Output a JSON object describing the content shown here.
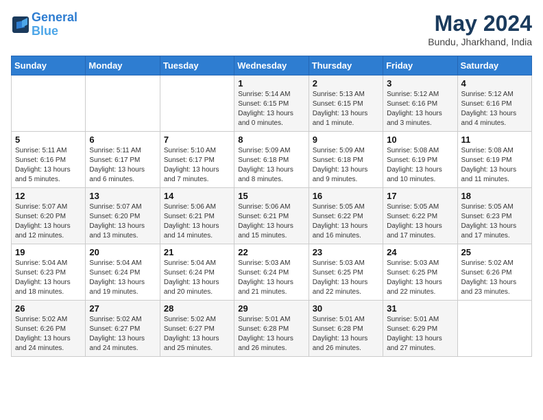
{
  "header": {
    "logo_line1": "General",
    "logo_line2": "Blue",
    "month": "May 2024",
    "location": "Bundu, Jharkhand, India"
  },
  "weekdays": [
    "Sunday",
    "Monday",
    "Tuesday",
    "Wednesday",
    "Thursday",
    "Friday",
    "Saturday"
  ],
  "weeks": [
    [
      {
        "day": "",
        "info": ""
      },
      {
        "day": "",
        "info": ""
      },
      {
        "day": "",
        "info": ""
      },
      {
        "day": "1",
        "info": "Sunrise: 5:14 AM\nSunset: 6:15 PM\nDaylight: 13 hours\nand 0 minutes."
      },
      {
        "day": "2",
        "info": "Sunrise: 5:13 AM\nSunset: 6:15 PM\nDaylight: 13 hours\nand 1 minute."
      },
      {
        "day": "3",
        "info": "Sunrise: 5:12 AM\nSunset: 6:16 PM\nDaylight: 13 hours\nand 3 minutes."
      },
      {
        "day": "4",
        "info": "Sunrise: 5:12 AM\nSunset: 6:16 PM\nDaylight: 13 hours\nand 4 minutes."
      }
    ],
    [
      {
        "day": "5",
        "info": "Sunrise: 5:11 AM\nSunset: 6:16 PM\nDaylight: 13 hours\nand 5 minutes."
      },
      {
        "day": "6",
        "info": "Sunrise: 5:11 AM\nSunset: 6:17 PM\nDaylight: 13 hours\nand 6 minutes."
      },
      {
        "day": "7",
        "info": "Sunrise: 5:10 AM\nSunset: 6:17 PM\nDaylight: 13 hours\nand 7 minutes."
      },
      {
        "day": "8",
        "info": "Sunrise: 5:09 AM\nSunset: 6:18 PM\nDaylight: 13 hours\nand 8 minutes."
      },
      {
        "day": "9",
        "info": "Sunrise: 5:09 AM\nSunset: 6:18 PM\nDaylight: 13 hours\nand 9 minutes."
      },
      {
        "day": "10",
        "info": "Sunrise: 5:08 AM\nSunset: 6:19 PM\nDaylight: 13 hours\nand 10 minutes."
      },
      {
        "day": "11",
        "info": "Sunrise: 5:08 AM\nSunset: 6:19 PM\nDaylight: 13 hours\nand 11 minutes."
      }
    ],
    [
      {
        "day": "12",
        "info": "Sunrise: 5:07 AM\nSunset: 6:20 PM\nDaylight: 13 hours\nand 12 minutes."
      },
      {
        "day": "13",
        "info": "Sunrise: 5:07 AM\nSunset: 6:20 PM\nDaylight: 13 hours\nand 13 minutes."
      },
      {
        "day": "14",
        "info": "Sunrise: 5:06 AM\nSunset: 6:21 PM\nDaylight: 13 hours\nand 14 minutes."
      },
      {
        "day": "15",
        "info": "Sunrise: 5:06 AM\nSunset: 6:21 PM\nDaylight: 13 hours\nand 15 minutes."
      },
      {
        "day": "16",
        "info": "Sunrise: 5:05 AM\nSunset: 6:22 PM\nDaylight: 13 hours\nand 16 minutes."
      },
      {
        "day": "17",
        "info": "Sunrise: 5:05 AM\nSunset: 6:22 PM\nDaylight: 13 hours\nand 17 minutes."
      },
      {
        "day": "18",
        "info": "Sunrise: 5:05 AM\nSunset: 6:23 PM\nDaylight: 13 hours\nand 17 minutes."
      }
    ],
    [
      {
        "day": "19",
        "info": "Sunrise: 5:04 AM\nSunset: 6:23 PM\nDaylight: 13 hours\nand 18 minutes."
      },
      {
        "day": "20",
        "info": "Sunrise: 5:04 AM\nSunset: 6:24 PM\nDaylight: 13 hours\nand 19 minutes."
      },
      {
        "day": "21",
        "info": "Sunrise: 5:04 AM\nSunset: 6:24 PM\nDaylight: 13 hours\nand 20 minutes."
      },
      {
        "day": "22",
        "info": "Sunrise: 5:03 AM\nSunset: 6:24 PM\nDaylight: 13 hours\nand 21 minutes."
      },
      {
        "day": "23",
        "info": "Sunrise: 5:03 AM\nSunset: 6:25 PM\nDaylight: 13 hours\nand 22 minutes."
      },
      {
        "day": "24",
        "info": "Sunrise: 5:03 AM\nSunset: 6:25 PM\nDaylight: 13 hours\nand 22 minutes."
      },
      {
        "day": "25",
        "info": "Sunrise: 5:02 AM\nSunset: 6:26 PM\nDaylight: 13 hours\nand 23 minutes."
      }
    ],
    [
      {
        "day": "26",
        "info": "Sunrise: 5:02 AM\nSunset: 6:26 PM\nDaylight: 13 hours\nand 24 minutes."
      },
      {
        "day": "27",
        "info": "Sunrise: 5:02 AM\nSunset: 6:27 PM\nDaylight: 13 hours\nand 24 minutes."
      },
      {
        "day": "28",
        "info": "Sunrise: 5:02 AM\nSunset: 6:27 PM\nDaylight: 13 hours\nand 25 minutes."
      },
      {
        "day": "29",
        "info": "Sunrise: 5:01 AM\nSunset: 6:28 PM\nDaylight: 13 hours\nand 26 minutes."
      },
      {
        "day": "30",
        "info": "Sunrise: 5:01 AM\nSunset: 6:28 PM\nDaylight: 13 hours\nand 26 minutes."
      },
      {
        "day": "31",
        "info": "Sunrise: 5:01 AM\nSunset: 6:29 PM\nDaylight: 13 hours\nand 27 minutes."
      },
      {
        "day": "",
        "info": ""
      }
    ]
  ]
}
